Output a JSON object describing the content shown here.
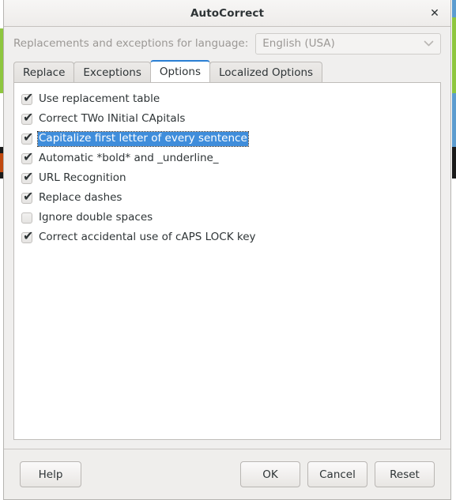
{
  "window": {
    "title": "AutoCorrect",
    "close_icon": "close-icon",
    "close_glyph": "✕"
  },
  "language": {
    "label": "Replacements and exceptions for language:",
    "value": "English (USA)",
    "chevron_icon": "chevron-down-icon"
  },
  "tabs": [
    {
      "label": "Replace",
      "active": false
    },
    {
      "label": "Exceptions",
      "active": false
    },
    {
      "label": "Options",
      "active": true
    },
    {
      "label": "Localized Options",
      "active": false
    }
  ],
  "options": [
    {
      "label": "Use replacement table",
      "checked": true,
      "selected": false
    },
    {
      "label": "Correct TWo INitial CApitals",
      "checked": true,
      "selected": false
    },
    {
      "label": "Capitalize first letter of every sentence",
      "checked": true,
      "selected": true
    },
    {
      "label": "Automatic *bold* and _underline_",
      "checked": true,
      "selected": false
    },
    {
      "label": "URL Recognition",
      "checked": true,
      "selected": false
    },
    {
      "label": "Replace dashes",
      "checked": true,
      "selected": false
    },
    {
      "label": "Ignore double spaces",
      "checked": false,
      "selected": false
    },
    {
      "label": "Correct accidental use of cAPS LOCK key",
      "checked": true,
      "selected": false
    }
  ],
  "check_glyph": "✔",
  "footer": {
    "help_label": "Help",
    "ok_label": "OK",
    "cancel_label": "Cancel",
    "reset_label": "Reset"
  },
  "colors": {
    "selection_blue": "#3f8ddb",
    "active_tab_accent": "#2a7fd4",
    "dialog_background": "#f0efee",
    "text": "#2e3436",
    "disabled_text": "#9b9895"
  }
}
